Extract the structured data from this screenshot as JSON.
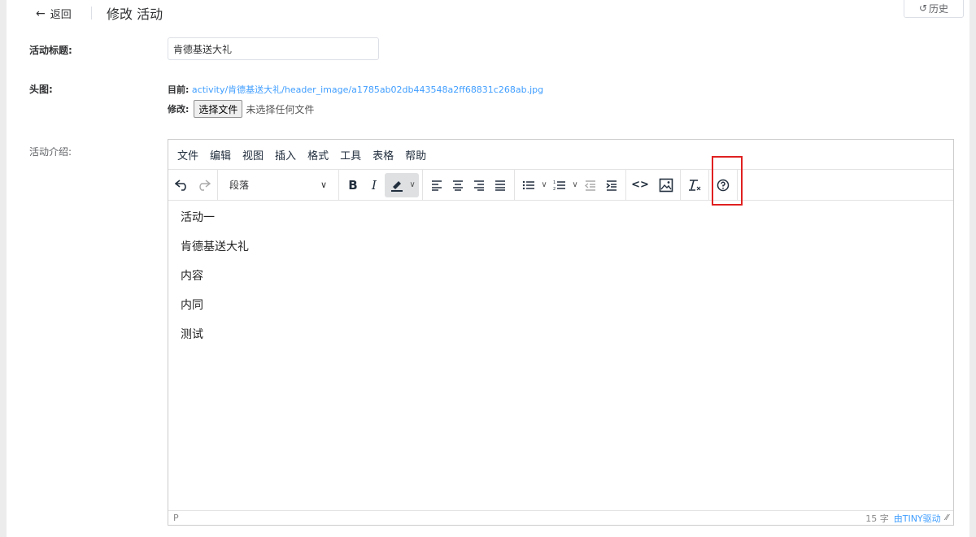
{
  "header": {
    "back_label": "返回",
    "page_title": "修改 活动",
    "history_label": "历史"
  },
  "form": {
    "title_label": "活动标题:",
    "title_value": "肯德基送大礼",
    "header_image_label": "头图:",
    "current_prefix": "目前:",
    "current_link": "activity/肯德基送大礼/header_image/a1785ab02db443548a2ff68831c268ab.jpg",
    "modify_prefix": "修改:",
    "file_button": "选择文件",
    "no_file_text": "未选择任何文件",
    "intro_label": "活动介绍:"
  },
  "editor": {
    "menu": [
      "文件",
      "编辑",
      "视图",
      "插入",
      "格式",
      "工具",
      "表格",
      "帮助"
    ],
    "block_format": "段落",
    "content": [
      "活动一",
      "肯德基送大礼",
      "内容",
      "内同",
      "测试"
    ],
    "status_path": "P",
    "word_count": "15 字",
    "brand": "由TINY驱动"
  },
  "colors": {
    "accent": "#409eff",
    "highlight_box": "#e02020"
  }
}
